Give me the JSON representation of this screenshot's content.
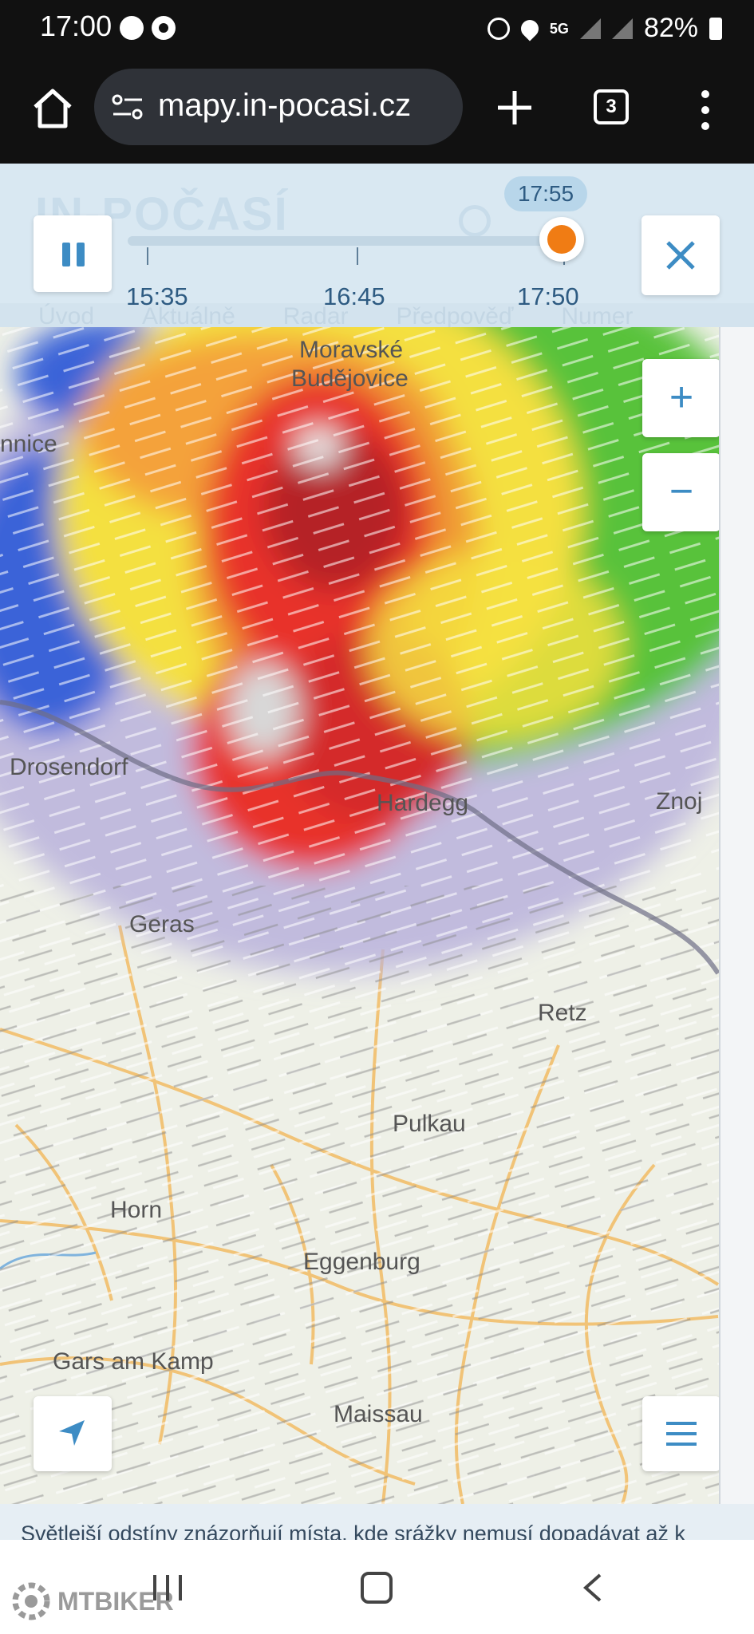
{
  "status_bar": {
    "time": "17:00",
    "network": "5G",
    "battery": "82%"
  },
  "browser": {
    "url": "mapy.in-pocasi.cz",
    "tab_count": "3"
  },
  "site": {
    "logo": "IN-POČASÍ",
    "nav": [
      "Úvod",
      "Aktuálně",
      "Radar",
      "Předpověď",
      "Numer"
    ]
  },
  "timeline": {
    "current_time": "17:55",
    "labels": [
      "15:35",
      "16:45",
      "17:50"
    ],
    "progress": 1.0
  },
  "map": {
    "towns": [
      "Moravské",
      "Budějovice",
      "nnice",
      "Drosendorf",
      "Hardegg",
      "Znoj",
      "Geras",
      "Retz",
      "Pulkau",
      "Horn",
      "Eggenburg",
      "Gars am Kamp",
      "Maissau"
    ],
    "zoom_in": "+",
    "zoom_out": "−"
  },
  "caption": "Světlejší odstíny znázorňují místa, kde srážky nemusí dopadávat až k",
  "watermark": "MTBIKER",
  "colors": {
    "accent": "#f07c14",
    "primary": "#3d8cc4",
    "radar_red": "#e8322a",
    "radar_green": "#58c23a",
    "radar_yellow": "#f4e040",
    "radar_blue": "#3b63d8",
    "radar_lilac": "#b9b2dc"
  },
  "icons": [
    "home-icon",
    "site-settings-icon",
    "new-tab-icon",
    "tabs-icon",
    "kebab-icon",
    "pause-icon",
    "close-icon",
    "zoom-in-icon",
    "zoom-out-icon",
    "locate-icon",
    "menu-icon"
  ]
}
